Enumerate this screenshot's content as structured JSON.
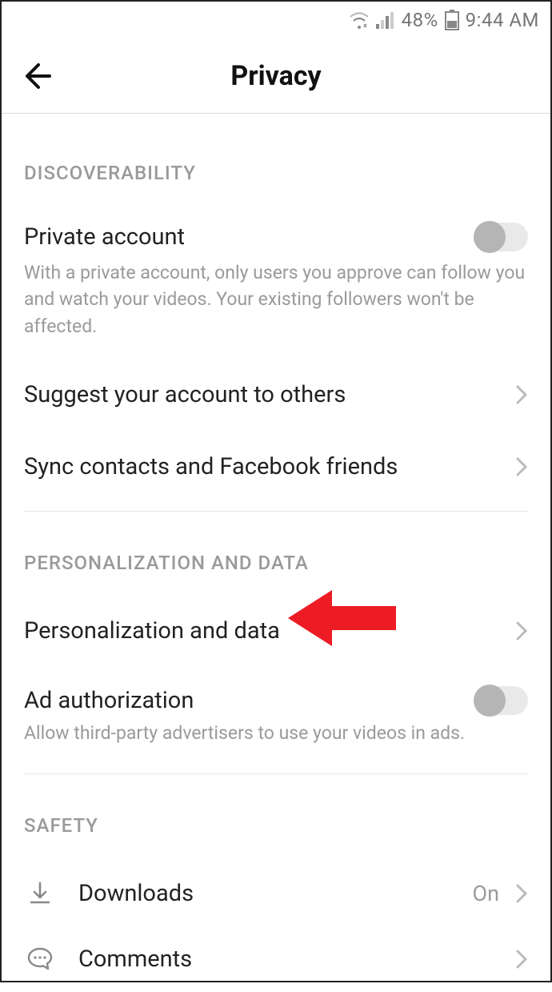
{
  "status_bar": {
    "battery_pct": "48%",
    "time": "9:44 AM"
  },
  "header": {
    "title": "Privacy"
  },
  "sections": {
    "discoverability": {
      "heading": "DISCOVERABILITY",
      "private_account": {
        "label": "Private account",
        "description": "With a private account, only users you approve can follow you and watch your videos. Your existing followers won't be affected.",
        "toggled": false
      },
      "suggest": {
        "label": "Suggest your account to others"
      },
      "sync": {
        "label": "Sync contacts and Facebook friends"
      }
    },
    "personalization": {
      "heading": "PERSONALIZATION AND DATA",
      "personalization": {
        "label": "Personalization and data"
      },
      "ad_auth": {
        "label": "Ad authorization",
        "description": "Allow third-party advertisers to use your videos in ads.",
        "toggled": false
      }
    },
    "safety": {
      "heading": "SAFETY",
      "downloads": {
        "label": "Downloads",
        "value": "On"
      },
      "comments": {
        "label": "Comments"
      }
    }
  }
}
